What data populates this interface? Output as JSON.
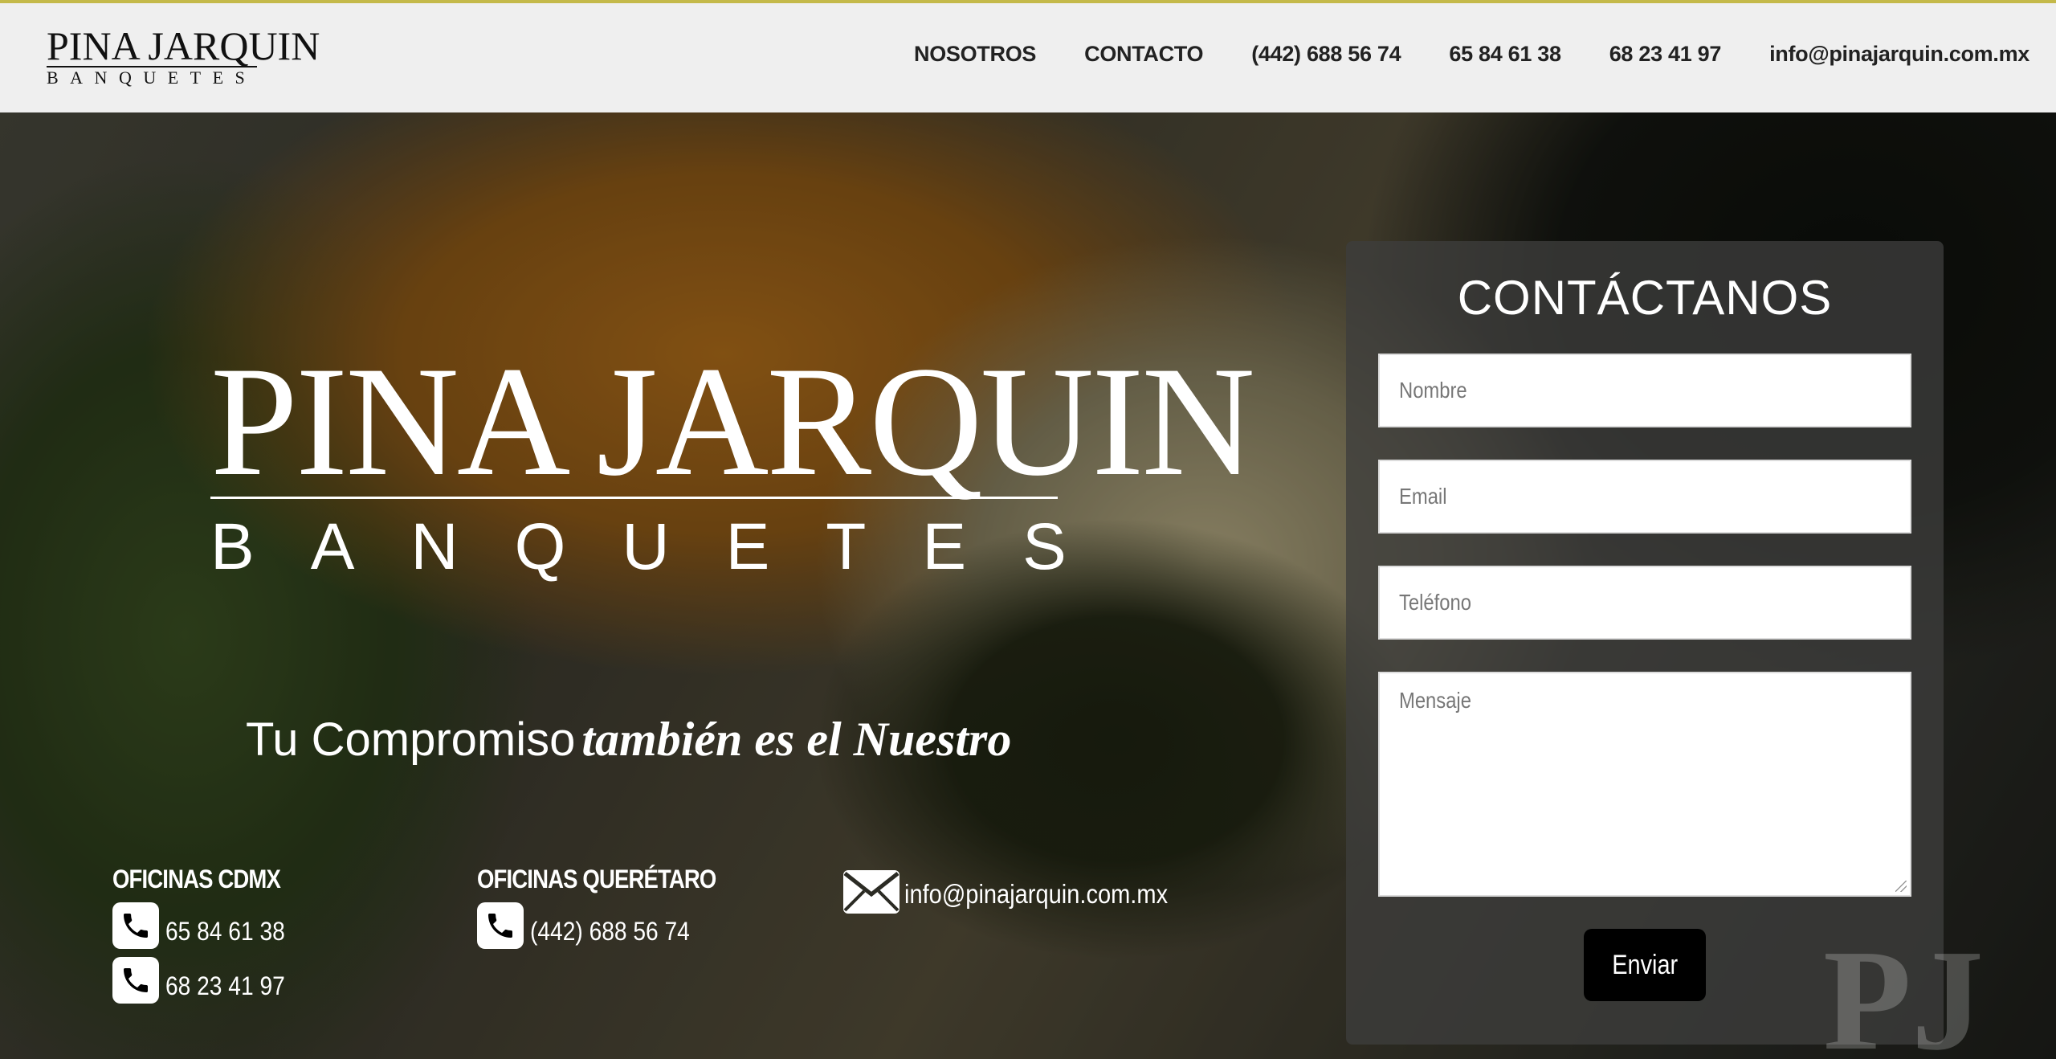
{
  "header": {
    "logo_line1": "PINA JARQUIN",
    "logo_line2": "BANQUETES",
    "nav": [
      "NOSOTROS",
      "CONTACTO",
      "(442) 688 56 74",
      "65 84 61 38",
      "68 23 41 97",
      "info@pinajarquin.com.mx"
    ]
  },
  "hero": {
    "logo_line1": "PINA JARQUIN",
    "logo_line2": "BANQUETES",
    "tagline_plain": "Tu Compromiso",
    "tagline_script": "también es el Nuestro"
  },
  "offices": {
    "cdmx": {
      "title": "OFICINAS CDMX",
      "phones": [
        "65 84 61 38",
        "68 23 41 97"
      ]
    },
    "queretaro": {
      "title": "OFICINAS QUERÉTARO",
      "phones": [
        "(442) 688 56 74"
      ]
    },
    "email": "info@pinajarquin.com.mx"
  },
  "form": {
    "title": "CONTÁCTANOS",
    "name_placeholder": "Nombre",
    "email_placeholder": "Email",
    "phone_placeholder": "Teléfono",
    "message_placeholder": "Mensaje",
    "submit_label": "Enviar"
  },
  "watermark": "PJ",
  "icons": {
    "phone": "phone-icon",
    "mail": "mail-icon"
  },
  "colors": {
    "header_bg": "#efefef",
    "accent_line": "#c4b94a",
    "button_bg": "#000000"
  }
}
